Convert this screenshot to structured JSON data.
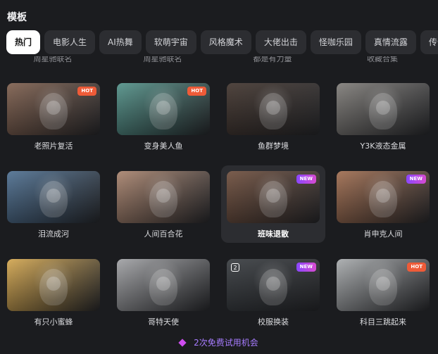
{
  "panel": {
    "title": "模板",
    "tabs": [
      {
        "label": "热门",
        "active": true
      },
      {
        "label": "电影人生",
        "active": false
      },
      {
        "label": "AI热舞",
        "active": false
      },
      {
        "label": "软萌宇宙",
        "active": false
      },
      {
        "label": "风格魔术",
        "active": false
      },
      {
        "label": "大佬出击",
        "active": false
      },
      {
        "label": "怪咖乐园",
        "active": false
      },
      {
        "label": "真情流露",
        "active": false
      },
      {
        "label": "传奇",
        "active": false
      }
    ],
    "cut_labels": [
      "周星驰联名",
      "周星驰联名",
      "都是有力量",
      "收藏合集"
    ],
    "templates": [
      {
        "name": "老照片复活",
        "badge": "HOT",
        "badge_kind": "hot",
        "icon": "",
        "selected": false,
        "accent": "#7c5c4a"
      },
      {
        "name": "变身美人鱼",
        "badge": "HOT",
        "badge_kind": "hot",
        "icon": "",
        "selected": false,
        "accent": "#4f8f86"
      },
      {
        "name": "鱼群梦境",
        "badge": "",
        "badge_kind": "",
        "icon": "",
        "selected": false,
        "accent": "#3d3029"
      },
      {
        "name": "Y3K液态金属",
        "badge": "",
        "badge_kind": "",
        "icon": "",
        "selected": false,
        "accent": "#7d7a76"
      },
      {
        "name": "泪流成河",
        "badge": "",
        "badge_kind": "",
        "icon": "",
        "selected": false,
        "accent": "#4b6d8f"
      },
      {
        "name": "人间百合花",
        "badge": "",
        "badge_kind": "",
        "icon": "",
        "selected": false,
        "accent": "#a7816b"
      },
      {
        "name": "班味退散",
        "badge": "NEW",
        "badge_kind": "new",
        "icon": "",
        "selected": true,
        "accent": "#6c4b39"
      },
      {
        "name": "肖申克人间",
        "badge": "NEW",
        "badge_kind": "new",
        "icon": "",
        "selected": false,
        "accent": "#9e6a4c"
      },
      {
        "name": "有只小蜜蜂",
        "badge": "",
        "badge_kind": "",
        "icon": "",
        "selected": false,
        "accent": "#d2a44b"
      },
      {
        "name": "哥特天使",
        "badge": "",
        "badge_kind": "",
        "icon": "",
        "selected": false,
        "accent": "#9fa0a3"
      },
      {
        "name": "校服换装",
        "badge": "NEW",
        "badge_kind": "new",
        "icon": "2",
        "selected": false,
        "accent": "#34383c"
      },
      {
        "name": "科目三跳起来",
        "badge": "HOT",
        "badge_kind": "hot",
        "icon": "",
        "selected": false,
        "accent": "#a6a9ab"
      }
    ],
    "footer": {
      "icon": "diamond-icon",
      "text": "2次免费试用机会"
    }
  }
}
